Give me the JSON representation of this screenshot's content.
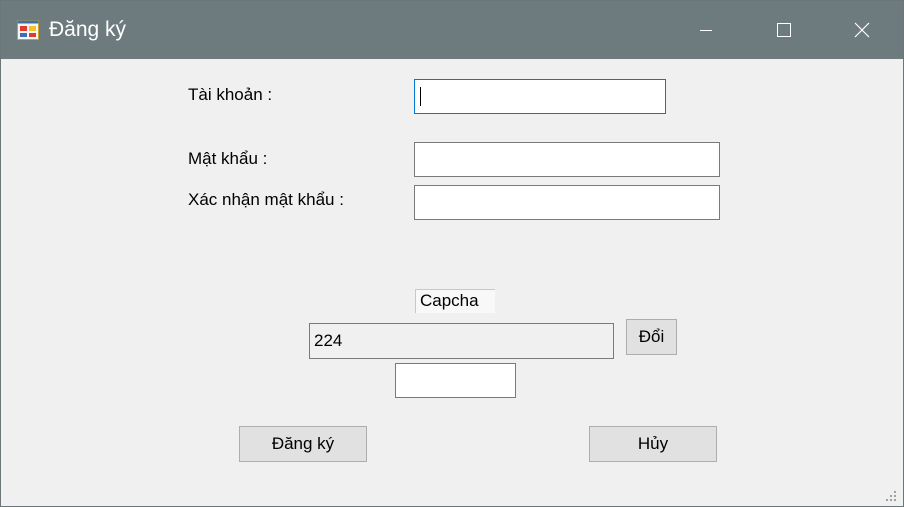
{
  "window": {
    "title": "Đăng ký",
    "icon": "app-form-icon",
    "controls": [
      "minimize-icon",
      "maximize-icon",
      "close-icon"
    ]
  },
  "form": {
    "username_label": "Tài khoản :",
    "username_value": "",
    "password_label": "Mật khẩu :",
    "password_value": "",
    "confirm_label": "Xác nhận mật khẩu :",
    "confirm_value": "",
    "captcha_label": "Capcha",
    "captcha_value": "224",
    "refresh_label": "Đổi",
    "captcha_input_value": ""
  },
  "actions": {
    "register_label": "Đăng ký",
    "cancel_label": "Hủy"
  },
  "colors": {
    "titlebar": "#6d7b7e",
    "window_bg": "#f0f0f0",
    "focus_border": "#0078d7",
    "button_bg": "#e1e1e1"
  }
}
